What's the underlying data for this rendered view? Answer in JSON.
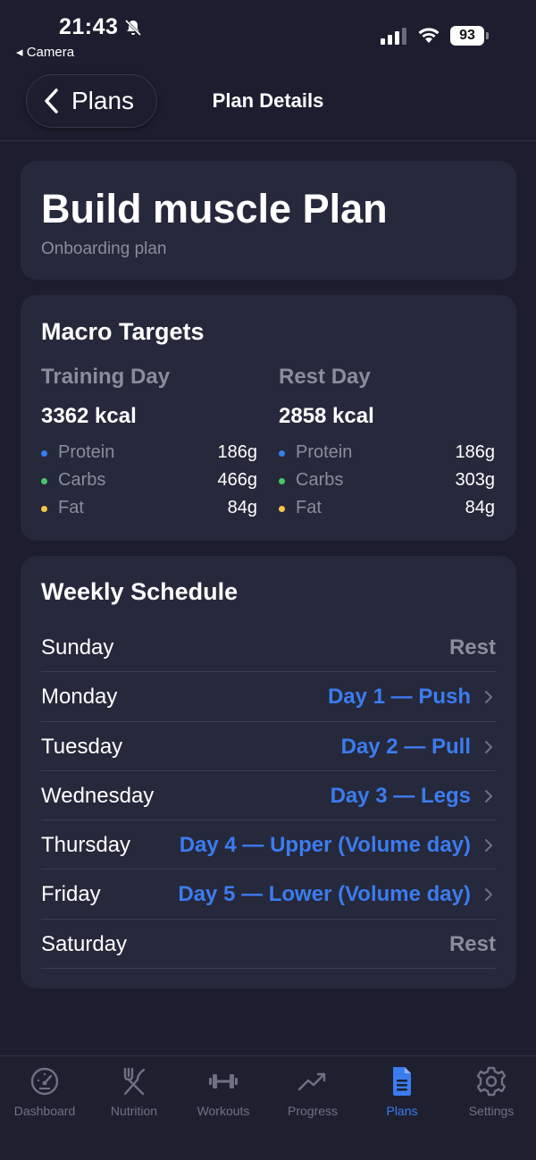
{
  "status_bar": {
    "time": "21:43",
    "back_app": "◂ Camera",
    "battery": "93"
  },
  "nav": {
    "back_label": "Plans",
    "title": "Plan Details"
  },
  "plan": {
    "title": "Build muscle Plan",
    "subtitle": "Onboarding plan"
  },
  "macros": {
    "heading": "Macro Targets",
    "training": {
      "title": "Training Day",
      "kcal": "3362 kcal",
      "items": [
        {
          "name": "Protein",
          "value": "186g",
          "color": "#3b7cf0"
        },
        {
          "name": "Carbs",
          "value": "466g",
          "color": "#4cc66a"
        },
        {
          "name": "Fat",
          "value": "84g",
          "color": "#f2c744"
        }
      ]
    },
    "rest": {
      "title": "Rest Day",
      "kcal": "2858 kcal",
      "items": [
        {
          "name": "Protein",
          "value": "186g",
          "color": "#3b7cf0"
        },
        {
          "name": "Carbs",
          "value": "303g",
          "color": "#4cc66a"
        },
        {
          "name": "Fat",
          "value": "84g",
          "color": "#f2c744"
        }
      ]
    }
  },
  "schedule": {
    "heading": "Weekly Schedule",
    "rows": [
      {
        "day": "Sunday",
        "assignment": "Rest"
      },
      {
        "day": "Monday",
        "assignment": "Day 1 — Push"
      },
      {
        "day": "Tuesday",
        "assignment": "Day 2 — Pull"
      },
      {
        "day": "Wednesday",
        "assignment": "Day 3 — Legs"
      },
      {
        "day": "Thursday",
        "assignment": "Day 4 — Upper (Volume day)"
      },
      {
        "day": "Friday",
        "assignment": "Day 5 — Lower (Volume day)"
      },
      {
        "day": "Saturday",
        "assignment": "Rest"
      }
    ]
  },
  "tabs": [
    {
      "label": "Dashboard",
      "icon": "gauge-icon"
    },
    {
      "label": "Nutrition",
      "icon": "fork-knife-icon"
    },
    {
      "label": "Workouts",
      "icon": "dumbbell-icon"
    },
    {
      "label": "Progress",
      "icon": "trend-up-icon"
    },
    {
      "label": "Plans",
      "icon": "document-icon",
      "active": true
    },
    {
      "label": "Settings",
      "icon": "gear-icon"
    }
  ],
  "colors": {
    "background": "#1c1d2e",
    "card": "#26283b",
    "accent": "#3b7cf0",
    "muted": "#8b8d9d"
  }
}
